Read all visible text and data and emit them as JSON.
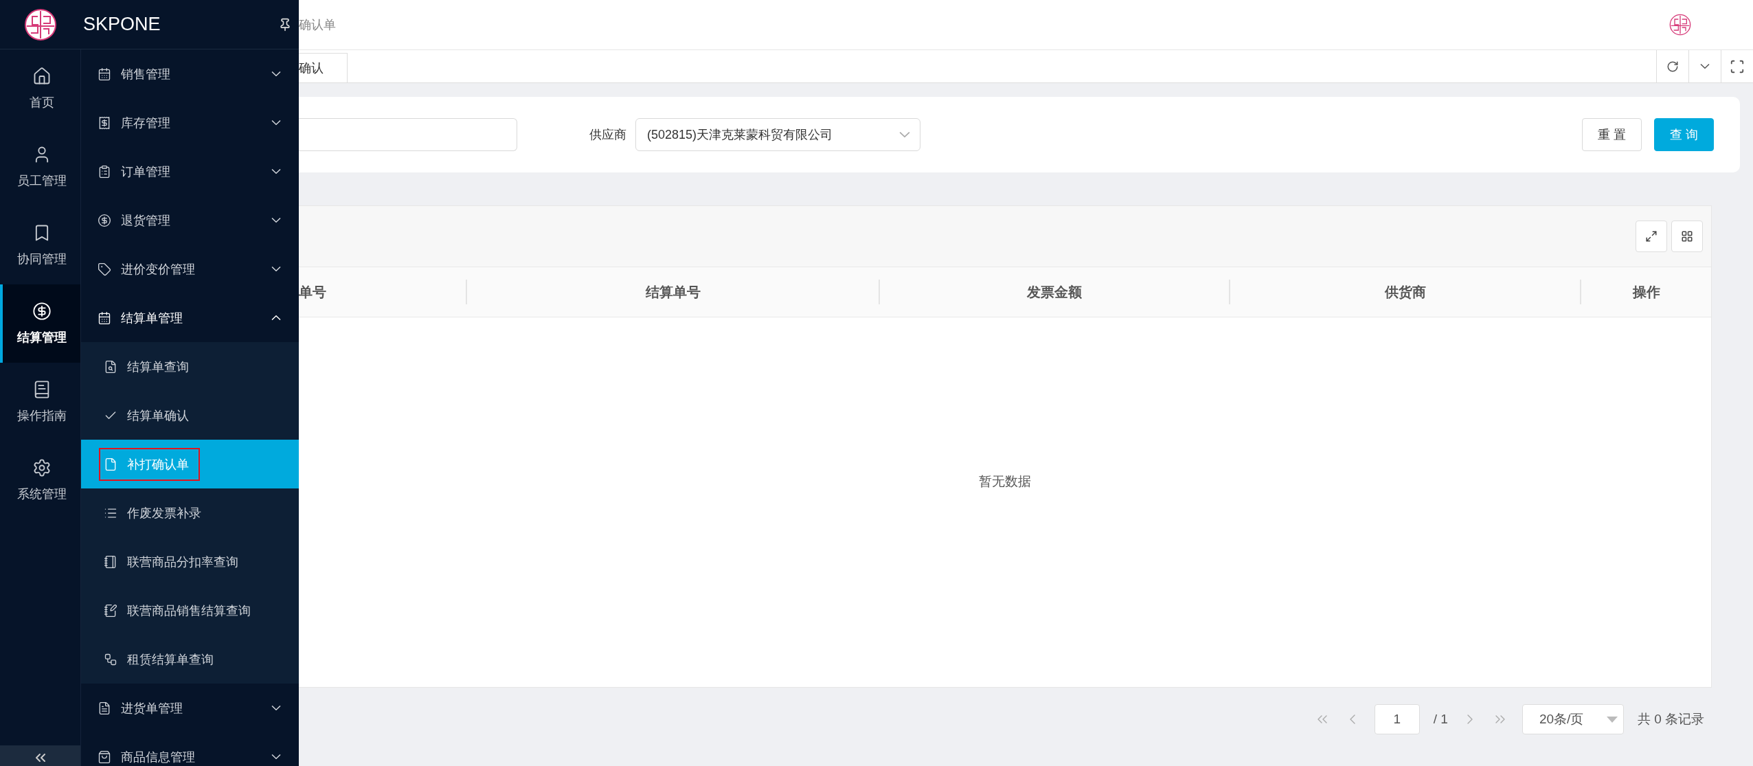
{
  "brand": {
    "name": "SKPONE"
  },
  "rail": [
    {
      "label": "首页",
      "selected": false
    },
    {
      "label": "员工管理",
      "selected": false
    },
    {
      "label": "协同管理",
      "selected": false
    },
    {
      "label": "结算管理",
      "selected": true
    },
    {
      "label": "操作指南",
      "selected": false
    },
    {
      "label": "系统管理",
      "selected": false
    }
  ],
  "menu": [
    {
      "label": "销售管理",
      "expanded": false
    },
    {
      "label": "库存管理",
      "expanded": false
    },
    {
      "label": "订单管理",
      "expanded": false
    },
    {
      "label": "退货管理",
      "expanded": false
    },
    {
      "label": "进价变价管理",
      "expanded": false
    },
    {
      "label": "结算单管理",
      "expanded": true,
      "children": [
        {
          "label": "结算单查询",
          "selected": false
        },
        {
          "label": "结算单确认",
          "selected": false
        },
        {
          "label": "补打确认单",
          "selected": true
        },
        {
          "label": "作废发票补录",
          "selected": false
        },
        {
          "label": "联营商品分扣率查询",
          "selected": false
        },
        {
          "label": "联营商品销售结算查询",
          "selected": false
        },
        {
          "label": "租赁结算单查询",
          "selected": false
        }
      ]
    },
    {
      "label": "进货单管理",
      "expanded": false
    },
    {
      "label": "商品信息管理",
      "expanded": false
    }
  ],
  "breadcrumb": "确认单",
  "tabs": [
    {
      "label": "确认",
      "selected": true
    }
  ],
  "filter": {
    "supplier_label": "供应商",
    "supplier_value": "(502815)天津克莱蒙科贸有限公司",
    "buttons": [
      {
        "label": "重 置",
        "kind": "default"
      },
      {
        "label": "查 询",
        "kind": "primary"
      }
    ]
  },
  "table": {
    "columns": [
      "单号",
      "结算单号",
      "发票金额",
      "供货商",
      "操作"
    ],
    "empty_text": "暂无数据"
  },
  "pagination": {
    "page": "1",
    "total_pages": "/ 1",
    "page_size": "20条/页",
    "summary": "共 0 条记录"
  }
}
